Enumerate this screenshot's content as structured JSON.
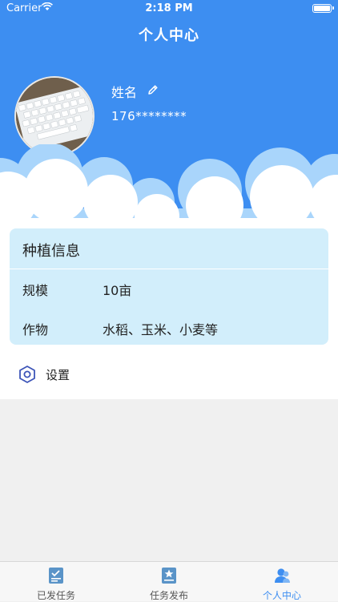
{
  "status_bar": {
    "carrier": "Carrier",
    "time": "2:18 PM"
  },
  "nav": {
    "title": "个人中心"
  },
  "profile": {
    "name": "姓名",
    "phone": "176********"
  },
  "planting": {
    "title": "种植信息",
    "rows": [
      {
        "label": "规模",
        "value": "10亩"
      },
      {
        "label": "作物",
        "value": "水稻、玉米、小麦等"
      }
    ]
  },
  "settings": {
    "label": "设置"
  },
  "tabs": [
    {
      "label": "已发任务",
      "icon": "task-list-icon"
    },
    {
      "label": "任务发布",
      "icon": "task-publish-icon"
    },
    {
      "label": "个人中心",
      "icon": "profile-icon"
    }
  ],
  "colors": {
    "primary": "#3d8ef1",
    "card_bg": "#d2eefb",
    "cloud_back": "#a9d5fb"
  }
}
